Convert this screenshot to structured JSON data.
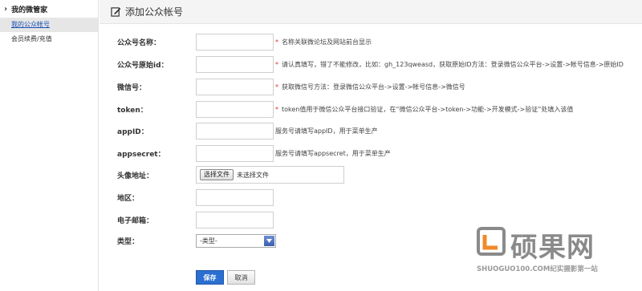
{
  "sidebar": {
    "heading": "我的微管家",
    "items": [
      {
        "label": "我的公众帐号",
        "active": true
      },
      {
        "label": "会员续费/充值",
        "active": false
      }
    ]
  },
  "header": {
    "title": "添加公众帐号",
    "icon": "edit-icon"
  },
  "form": {
    "fields": [
      {
        "label": "公众号名称：",
        "value": "",
        "hint": "名称关联微论坛及网站前台显示",
        "required": true
      },
      {
        "label": "公众号原始id：",
        "value": "",
        "hint": "请认真填写，错了不能修改，比如：gh_123qweasd，获取原始ID方法：登录微信公众平台->设置->帐号信息->原始ID",
        "required": true
      },
      {
        "label": "微信号：",
        "value": "",
        "hint": "获取微信号方法：登录微信公众平台->设置->帐号信息->微信号",
        "required": true
      },
      {
        "label": "token：",
        "value": "",
        "hint": "token值用于微信公众平台接口验证，在“微信公众平台->token->功能->开发模式->验证”处填入该值",
        "required": true
      },
      {
        "label": "appID：",
        "value": "",
        "hint": "服务号请填写appID，用于菜单生产",
        "required": false
      },
      {
        "label": "appsecret：",
        "value": "",
        "hint": "服务号请填写appsecret，用于菜单生产",
        "required": false
      }
    ],
    "avatar": {
      "label": "头像地址：",
      "button": "选择文件",
      "status": "未选择文件"
    },
    "region": {
      "label": "地区：",
      "value": ""
    },
    "email": {
      "label": "电子邮箱：",
      "value": ""
    },
    "type": {
      "label": "类型：",
      "selected": "-类型-"
    },
    "save_label": "保存",
    "cancel_label": "取消"
  },
  "watermark": {
    "brand": "硕果网",
    "tagline": "SHUOGUO100.COM纪实摄影第一站",
    "color": "#8a8a8a",
    "accent": "#f08a2a"
  },
  "colors": {
    "primary_button": "#2b6fd1",
    "required_star": "#e0301e",
    "active_link": "#1a4fb3"
  }
}
